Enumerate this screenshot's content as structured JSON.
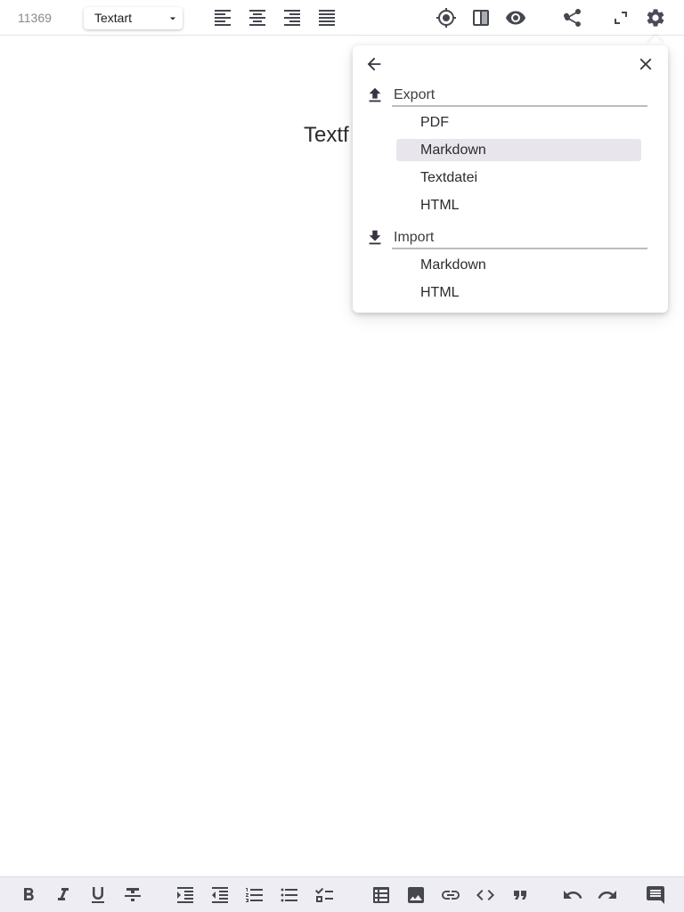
{
  "toolbar": {
    "counter": "11369",
    "select_value": "Textart",
    "icons": [
      "align-left-icon",
      "align-center-icon",
      "align-right-icon",
      "align-justify-icon",
      "target-icon",
      "split-view-icon",
      "preview-eye-icon",
      "share-icon",
      "fullscreen-icon",
      "settings-gear-icon"
    ]
  },
  "document": {
    "visible_text": "Textf"
  },
  "menu": {
    "export": {
      "label": "Export",
      "items": [
        "PDF",
        "Markdown",
        "Textdatei",
        "HTML"
      ],
      "highlighted": "Markdown"
    },
    "import": {
      "label": "Import",
      "items": [
        "Markdown",
        "HTML"
      ]
    }
  },
  "bottombar": {
    "icons": [
      "bold-icon",
      "italic-icon",
      "underline-icon",
      "strikethrough-icon",
      "indent-increase-icon",
      "indent-decrease-icon",
      "numbered-list-icon",
      "bulleted-list-icon",
      "checklist-icon",
      "table-icon",
      "image-icon",
      "link-icon",
      "code-icon",
      "quote-icon",
      "undo-icon",
      "redo-icon",
      "comment-icon"
    ]
  },
  "colors": {
    "bottombar_bg": "#eeedf3",
    "menu_highlight": "#e8e6ec",
    "icon": "#44474e"
  }
}
